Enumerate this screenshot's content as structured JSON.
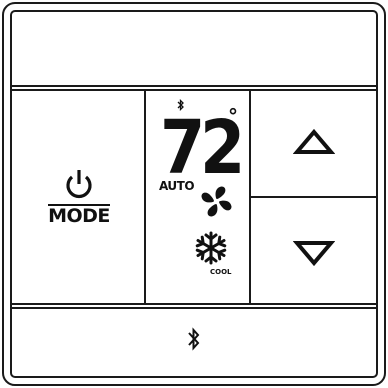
{
  "thermostat": {
    "mode_label": "MODE",
    "temperature": "72",
    "degree_symbol": "°",
    "fan_mode": "AUTO",
    "system_mode": "COOL",
    "icons": {
      "power": "power-icon",
      "bluetooth_status": "bluetooth-icon",
      "fan": "fan-icon",
      "cool": "snowflake-icon",
      "up": "triangle-up-icon",
      "down": "triangle-down-icon",
      "bluetooth_button": "bluetooth-icon"
    },
    "colors": {
      "ink": "#111111",
      "background": "#ffffff"
    }
  }
}
